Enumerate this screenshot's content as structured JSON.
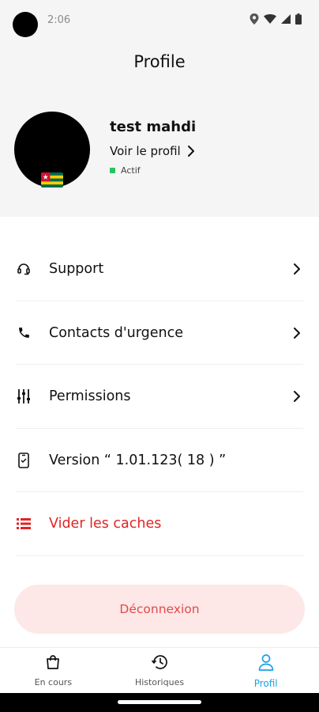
{
  "status_bar": {
    "time": "2:06",
    "icons": [
      "location-icon",
      "wifi-icon",
      "signal-icon",
      "battery-icon"
    ]
  },
  "header": {
    "title": "Profile"
  },
  "profile": {
    "name": "test mahdi",
    "link_label": "Voir le profil",
    "status_label": "Actif",
    "status_color": "#22c55e",
    "flag": "togo-flag-icon"
  },
  "menu": {
    "items": [
      {
        "label": "Support",
        "icon": "headset-icon"
      },
      {
        "label": "Contacts d'urgence",
        "icon": "phone-icon"
      },
      {
        "label": "Permissions",
        "icon": "sliders-icon"
      },
      {
        "label": "Version “ 1.01.123( 18 ) ”",
        "icon": "phone-device-icon"
      },
      {
        "label": "Vider les caches",
        "icon": "list-icon"
      }
    ]
  },
  "logout": {
    "label": "Déconnexion",
    "color": "#e24a4a",
    "background": "#fde7e7"
  },
  "bottom_nav": {
    "items": [
      {
        "label": "En cours",
        "icon": "shopping-bag-icon"
      },
      {
        "label": "Historiques",
        "icon": "history-icon"
      },
      {
        "label": "Profil",
        "icon": "user-icon",
        "active": true
      }
    ],
    "active_color": "#1aa1e6"
  },
  "colors": {
    "accent": "#1aa1e6",
    "danger": "#e02424",
    "header_bg": "#f5f5f5"
  }
}
